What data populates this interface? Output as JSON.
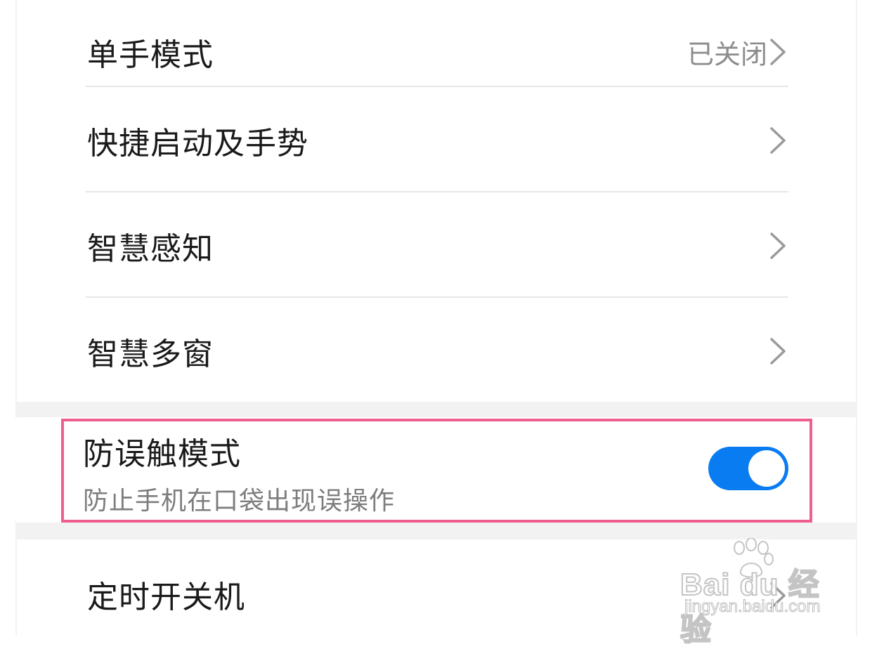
{
  "settings": {
    "items": [
      {
        "label": "单手模式",
        "value": "已关闭"
      },
      {
        "label": "快捷启动及手势",
        "value": ""
      },
      {
        "label": "智慧感知",
        "value": ""
      },
      {
        "label": "智慧多窗",
        "value": ""
      }
    ],
    "toggle_item": {
      "label": "防误触模式",
      "description": "防止手机在口袋出现误操作",
      "enabled": true
    },
    "bottom_item": {
      "label": "定时开关机"
    }
  },
  "watermark": {
    "brand": "Bai du 经验",
    "url": "jingyan.baidu.com"
  },
  "colors": {
    "toggle_on": "#0a7cf2",
    "highlight_border": "#ef5f8d",
    "section_gap": "#f2f2f2"
  },
  "icons": {
    "chevron": "chevron-right-icon",
    "watermark_logo": "paw-icon"
  }
}
